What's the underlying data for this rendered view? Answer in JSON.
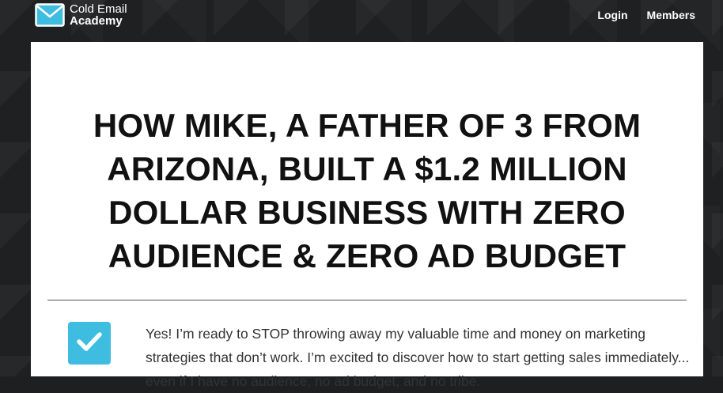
{
  "header": {
    "logo": {
      "line1": "Cold Email",
      "line2": "Academy"
    },
    "nav": {
      "login": "Login",
      "members": "Members"
    }
  },
  "main": {
    "headline": "HOW MIKE, A FATHER OF 3 FROM ARIZONA, BUILT A $1.2 MILLION DOLLAR BUSINESS WITH ZERO AUDIENCE & ZERO AD BUDGET",
    "optin_text": "Yes! I’m ready to STOP throwing away my valuable time and money on marketing strategies that don’t work. I’m excited to discover how to start getting sales immediately... even if I have no audience, no ad budget, and no tribe.",
    "checkbox_checked": true
  },
  "colors": {
    "background": "#1e1f21",
    "accent": "#3fbde0",
    "content_bg": "#ffffff",
    "text": "#111111"
  },
  "icons": {
    "logo": "envelope-icon",
    "checkbox": "checkmark-icon"
  }
}
